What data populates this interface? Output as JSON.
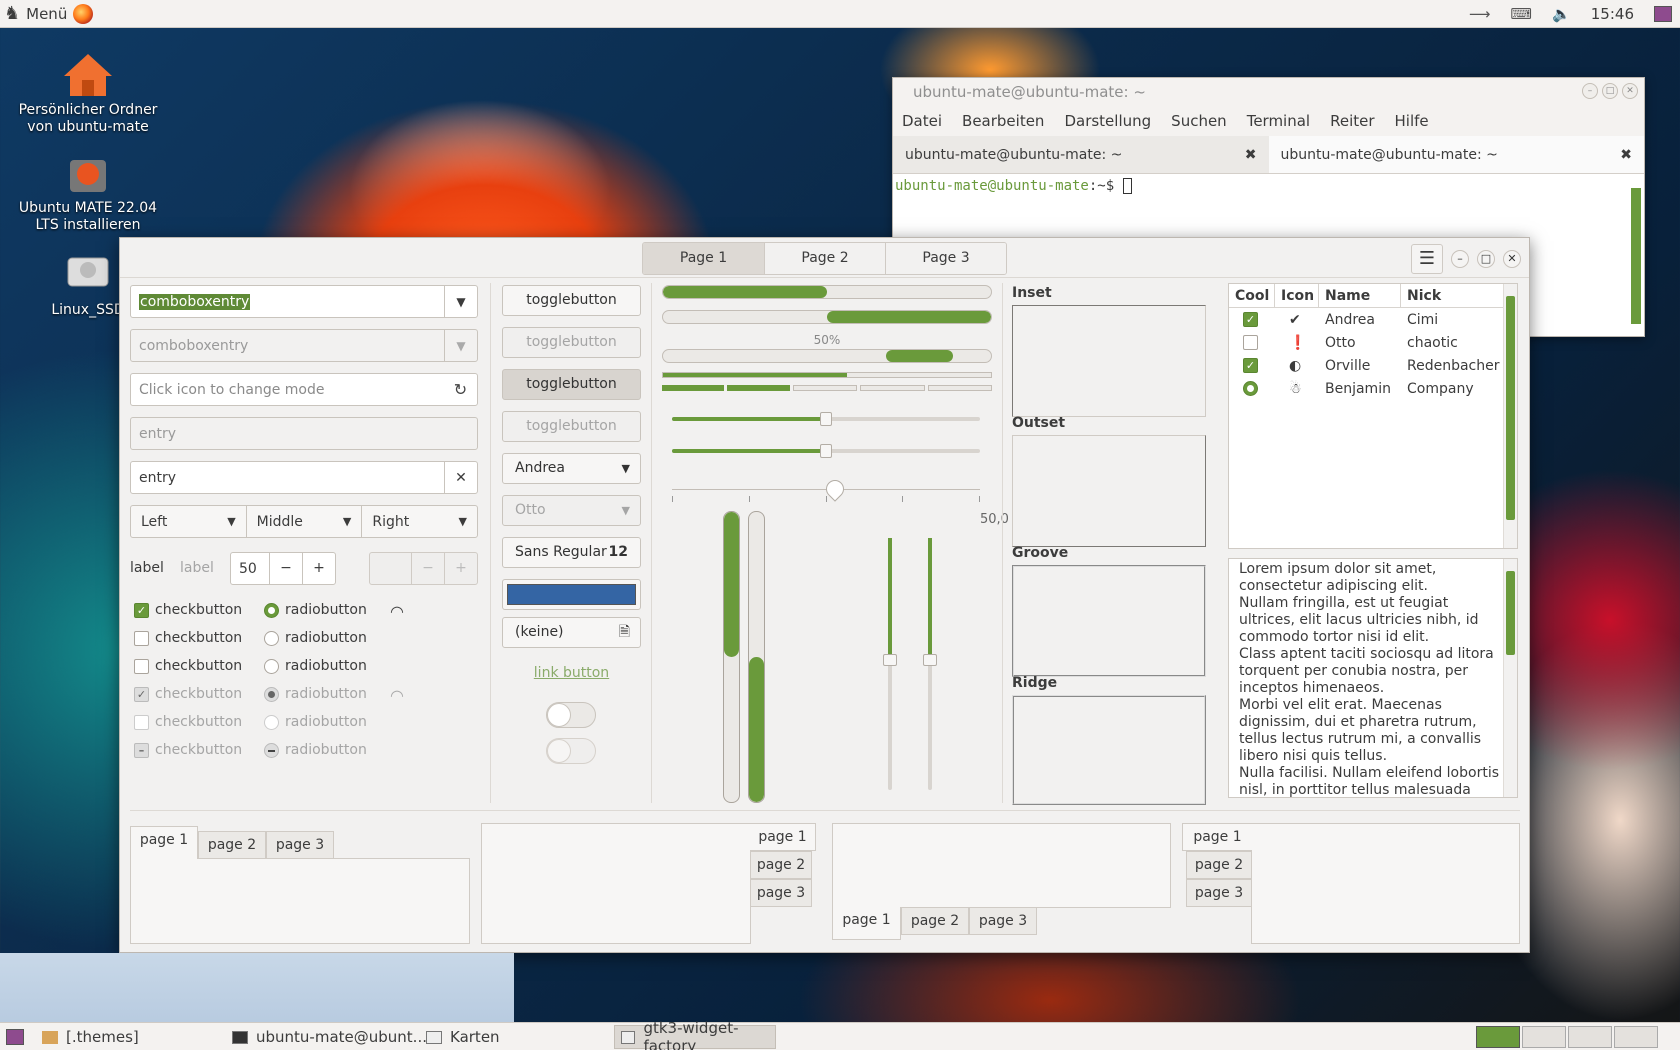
{
  "topbar": {
    "menu_label": "Menü",
    "clock": "15:46"
  },
  "desktop": {
    "icons": [
      "Persönlicher Ordner von ubuntu-mate",
      "Ubuntu MATE 22.04 LTS installieren",
      "Linux_SSD"
    ]
  },
  "terminal": {
    "title": "ubuntu-mate@ubuntu-mate: ~",
    "menus": [
      "Datei",
      "Bearbeiten",
      "Darstellung",
      "Suchen",
      "Terminal",
      "Reiter",
      "Hilfe"
    ],
    "tabs": [
      "ubuntu-mate@ubuntu-mate: ~",
      "ubuntu-mate@ubuntu-mate: ~"
    ],
    "prompt_user": "ubuntu-mate@ubuntu-mate",
    "prompt_path": ":~$"
  },
  "factory": {
    "stack": [
      "Page 1",
      "Page 2",
      "Page 3"
    ],
    "col1": {
      "combo1": "comboboxentry",
      "combo2": "comboboxentry",
      "mode_placeholder": "Click icon to change mode",
      "entry_dis": "entry",
      "entry": "entry",
      "combos": [
        "Left",
        "Middle",
        "Right"
      ],
      "label1": "label",
      "label2": "label",
      "spin": "50",
      "checks": [
        "checkbutton",
        "checkbutton",
        "checkbutton",
        "checkbutton",
        "checkbutton",
        "checkbutton"
      ],
      "radios": [
        "radiobutton",
        "radiobutton",
        "radiobutton",
        "radiobutton",
        "radiobutton",
        "radiobutton"
      ]
    },
    "col2": {
      "toggles": [
        "togglebutton",
        "togglebutton",
        "togglebutton",
        "togglebutton"
      ],
      "combo_a": "Andrea",
      "combo_b": "Otto",
      "font_name": "Sans Regular",
      "font_size": "12",
      "file": "(keine)",
      "link": "link button",
      "color": "#3465a4"
    },
    "col3": {
      "progress_label": "50%",
      "scale_value": "50,0",
      "progress": [
        0.5,
        0.5,
        0.5
      ]
    },
    "frames": [
      "Inset",
      "Outset",
      "Groove",
      "Ridge"
    ],
    "tree": {
      "headers": [
        "Cool",
        "Icon",
        "Name",
        "Nick"
      ],
      "rows": [
        {
          "cool": "checked",
          "name": "Andrea",
          "nick": "Cimi"
        },
        {
          "cool": "unchecked",
          "name": "Otto",
          "nick": "chaotic"
        },
        {
          "cool": "checked",
          "name": "Orville",
          "nick": "Redenbacher"
        },
        {
          "cool": "radio",
          "name": "Benjamin",
          "nick": "Company"
        }
      ]
    },
    "textview": [
      "Lorem ipsum dolor sit amet, consectetur adipiscing elit.",
      "Nullam fringilla, est ut feugiat ultrices, elit lacus ultricies nibh, id commodo tortor nisi id elit.",
      "Class aptent taciti sociosqu ad litora torquent per conubia nostra, per inceptos himenaeos.",
      "Morbi vel elit erat. Maecenas dignissim, dui et pharetra rutrum, tellus lectus rutrum mi, a convallis libero nisi quis tellus.",
      "Nulla facilisi. Nullam eleifend lobortis nisl, in porttitor tellus malesuada"
    ],
    "notebook_tabs": [
      "page 1",
      "page 2",
      "page 3"
    ]
  },
  "taskbar": {
    "items": [
      "[.themes]",
      "ubuntu-mate@ubunt...",
      "Karten",
      "gtk3-widget-factory"
    ]
  },
  "colors": {
    "accent": "#6a9a3b",
    "selection": "#5f8a36"
  }
}
